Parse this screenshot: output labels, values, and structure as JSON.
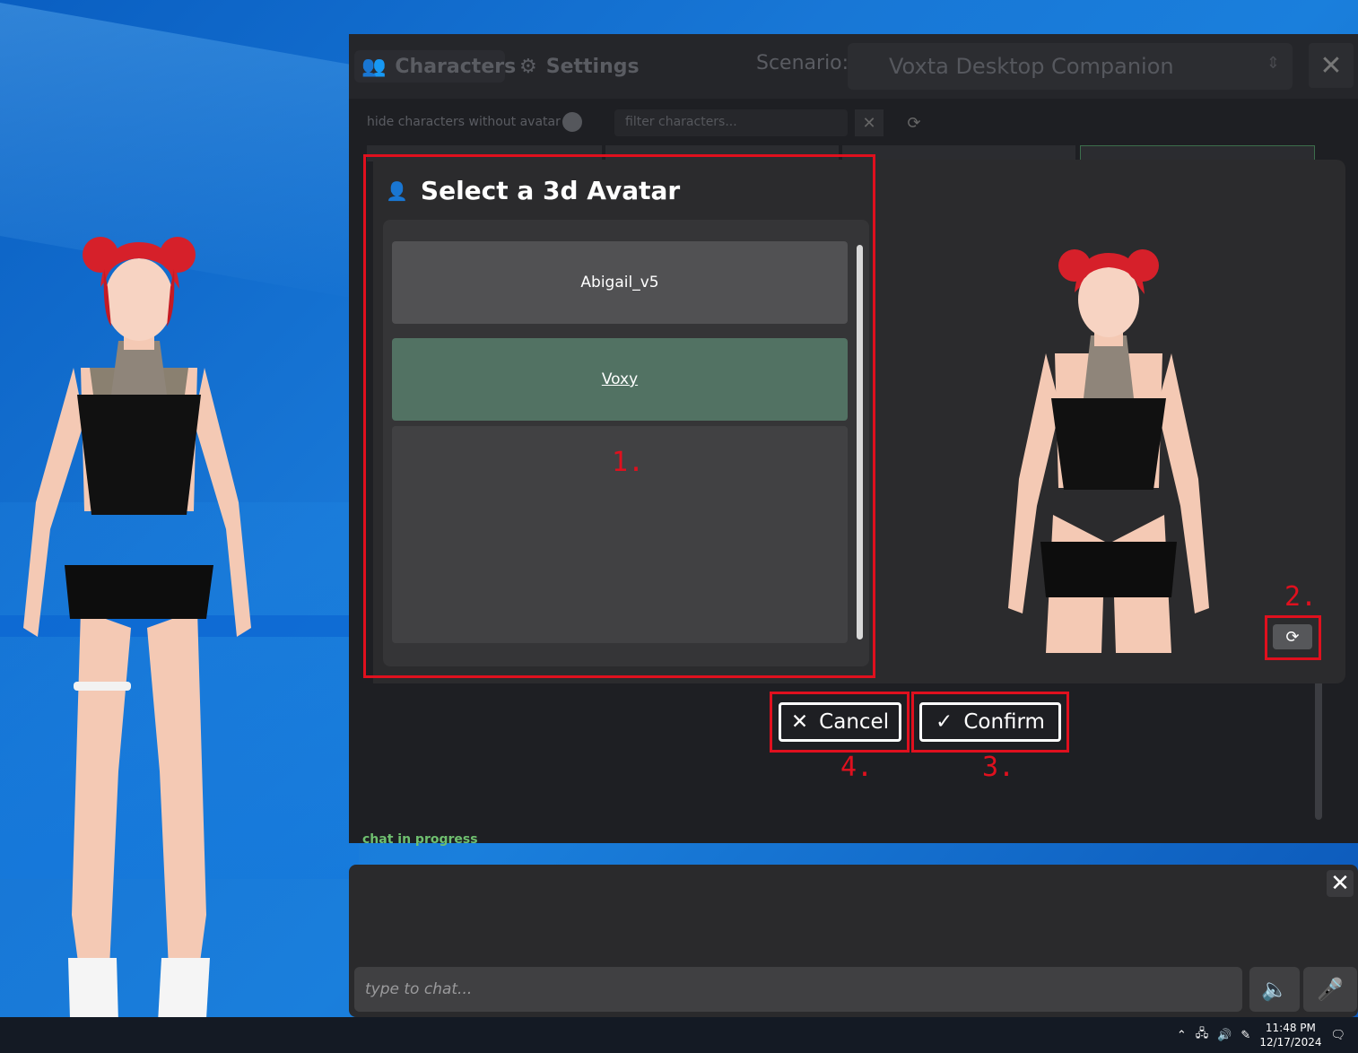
{
  "app": {
    "tabs": [
      {
        "label": "Characters",
        "icon": "people-icon"
      },
      {
        "label": "Settings",
        "icon": "gear-icon"
      }
    ],
    "scenario_label": "Scenario:",
    "scenario_value": "Voxta Desktop Companion",
    "close_icon": "close-icon"
  },
  "filter": {
    "hide_toggle_label": "hide characters without avatar",
    "filter_placeholder": "filter characters..."
  },
  "status": "chat in progress",
  "modal": {
    "title": "Select a 3d Avatar",
    "title_icon": "user-edit-icon",
    "avatars": [
      {
        "label": "Abigail_v5",
        "selected": false
      },
      {
        "label": "Voxy",
        "selected": true
      }
    ]
  },
  "buttons": {
    "cancel": "Cancel",
    "confirm": "Confirm"
  },
  "annotations": {
    "a1": "1.",
    "a2": "2.",
    "a3": "3.",
    "a4": "4."
  },
  "chat": {
    "input_placeholder": "type to chat..."
  },
  "taskbar": {
    "time": "11:48 PM",
    "date": "12/17/2024"
  },
  "colors": {
    "accent_red": "#e0101e",
    "selected_item": "#527263",
    "status_green": "#6fbf6f"
  }
}
